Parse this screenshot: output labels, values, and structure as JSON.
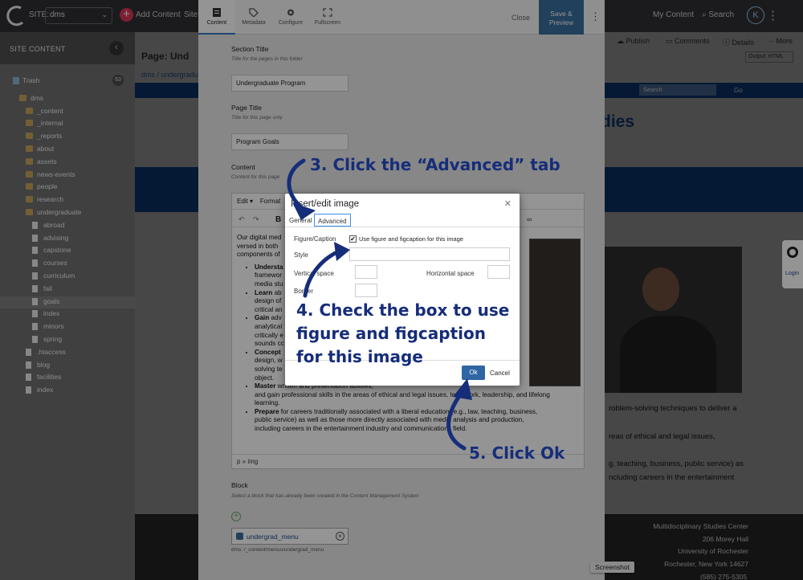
{
  "topbar": {
    "site_label": "SITE:",
    "site_value": "dms",
    "add_content": "Add Content",
    "site_link": "Site",
    "my_content": "My Content",
    "search": "Search",
    "avatar_initial": "K"
  },
  "sidebar": {
    "header": "SITE CONTENT",
    "trash_label": "Trash",
    "trash_count": "63",
    "items": [
      {
        "label": "dms",
        "type": "folder",
        "indent": 1
      },
      {
        "label": "_content",
        "type": "folder",
        "indent": 2
      },
      {
        "label": "_internal",
        "type": "folder",
        "indent": 2
      },
      {
        "label": "_reports",
        "type": "folder",
        "indent": 2
      },
      {
        "label": "about",
        "type": "folder",
        "indent": 2
      },
      {
        "label": "assets",
        "type": "folder",
        "indent": 2
      },
      {
        "label": "news-events",
        "type": "folder",
        "indent": 2
      },
      {
        "label": "people",
        "type": "folder",
        "indent": 2
      },
      {
        "label": "research",
        "type": "folder",
        "indent": 2
      },
      {
        "label": "undergraduate",
        "type": "folder",
        "indent": 2
      },
      {
        "label": "abroad",
        "type": "file",
        "indent": 3
      },
      {
        "label": "advising",
        "type": "file",
        "indent": 3
      },
      {
        "label": "capstone",
        "type": "file",
        "indent": 3
      },
      {
        "label": "courses",
        "type": "file",
        "indent": 3
      },
      {
        "label": "curriculum",
        "type": "file",
        "indent": 3
      },
      {
        "label": "fall",
        "type": "file",
        "indent": 3
      },
      {
        "label": "goals",
        "type": "file",
        "indent": 3,
        "selected": true
      },
      {
        "label": "index",
        "type": "file",
        "indent": 3
      },
      {
        "label": "minors",
        "type": "file",
        "indent": 3
      },
      {
        "label": "spring",
        "type": "file",
        "indent": 3
      },
      {
        "label": ".htaccess",
        "type": "file",
        "indent": 2
      },
      {
        "label": "blog",
        "type": "file",
        "indent": 2
      },
      {
        "label": "facilities",
        "type": "file",
        "indent": 2
      },
      {
        "label": "index",
        "type": "file",
        "indent": 2
      }
    ]
  },
  "background_page": {
    "page_title": "Page: Und",
    "breadcrumb": "dms / undergradu",
    "publish": "Publish",
    "comments": "Comments",
    "details": "Details",
    "more": "More",
    "output": "Output: HTML",
    "search_placeholder": "Search",
    "go": "Go",
    "heading_fragment": "dies",
    "text_lines": [
      "roblem-solving techniques to deliver a",
      "reas of ethical and legal issues,",
      "g, teaching, business, public service) as",
      "ncluding careers in the entertainment"
    ],
    "footer_address": [
      "Multidisciplinary Studies Center",
      "206 Morey Hall",
      "University of Rochester",
      "Rochester, New York 14627"
    ],
    "phone": "(585) 275-5305",
    "login": "Login",
    "screenshot_tip": "Screenshot"
  },
  "panel": {
    "tabs": [
      {
        "label": "Content",
        "icon": "document-icon",
        "active": true
      },
      {
        "label": "Metadata",
        "icon": "tag-icon"
      },
      {
        "label": "Configure",
        "icon": "gear-icon"
      },
      {
        "label": "Fullscreen",
        "icon": "fullscreen-icon"
      }
    ],
    "close": "Close",
    "save_preview_line1": "Save &",
    "save_preview_line2": "Preview",
    "section_title_label": "Section Title",
    "section_title_help": "Title for the pages in this folder",
    "section_title_value": "Undergraduate Program",
    "page_title_label": "Page Title",
    "page_title_help": "Title for this page only",
    "page_title_value": "Program Goals",
    "content_label": "Content",
    "content_help": "Content for this page",
    "editor_menu_edit": "Edit ▾",
    "editor_menu_format": "Format",
    "editor_status": "p » img",
    "editor_intro": "Our digital med",
    "editor_intro2": "versed in both",
    "editor_intro3": "components of",
    "editor_bullets": [
      {
        "bold": "Understa",
        "rest": "",
        "lines": [
          "framewor",
          "media stu"
        ]
      },
      {
        "bold": "Learn",
        "rest": " ab",
        "lines": [
          "design of",
          "critical an"
        ]
      },
      {
        "bold": "Gain",
        "rest": " adv",
        "lines": [
          "analytical",
          "critically e",
          "sounds cc"
        ]
      },
      {
        "bold": "Concept",
        "rest": "",
        "lines": [
          "design, w",
          "solving te",
          "object."
        ]
      },
      {
        "bold": "Master",
        "rest": " written and presentation abilities,",
        "lines": [
          "and gain professional skills in the areas of ethical and legal issues, teamwork, leadership, and lifelong",
          "learning."
        ]
      },
      {
        "bold": "Prepare",
        "rest": " for careers traditionally associated with a liberal education (e.g., law, teaching, business,",
        "lines": [
          "public service) as well as those more directly associated with media analysis and production,",
          "including careers in the entertainment industry and communications field."
        ]
      }
    ],
    "block_label": "Block",
    "block_help": "Select a block that has already been created in the Content Management System",
    "block_value": "undergrad_menu",
    "block_path": "dms: /_content/menus/undergrad_menu"
  },
  "dialog": {
    "title": "Insert/edit image",
    "tab_general": "General",
    "tab_advanced": "Advanced",
    "figure_label": "Figure/Caption",
    "figure_checkbox_label": "Use figure and figcaption for this image",
    "figure_checked": true,
    "style_label": "Style",
    "vspace_label": "Vertical space",
    "hspace_label": "Horizontal space",
    "border_label": "Border",
    "ok": "Ok",
    "cancel": "Cancel"
  },
  "annotations": {
    "step3": "3. Click the “Advanced” tab",
    "step4_line1": "4. Check the box to use",
    "step4_line2": "figure and figcaption",
    "step4_line3": "for this image",
    "step5": "5. Click Ok"
  },
  "colors": {
    "annotation": "#162d7a",
    "save_button": "#3a6f9d",
    "ok_button": "#2f66a3",
    "navy": "#0c2c5a",
    "add_button": "#d6345b"
  }
}
